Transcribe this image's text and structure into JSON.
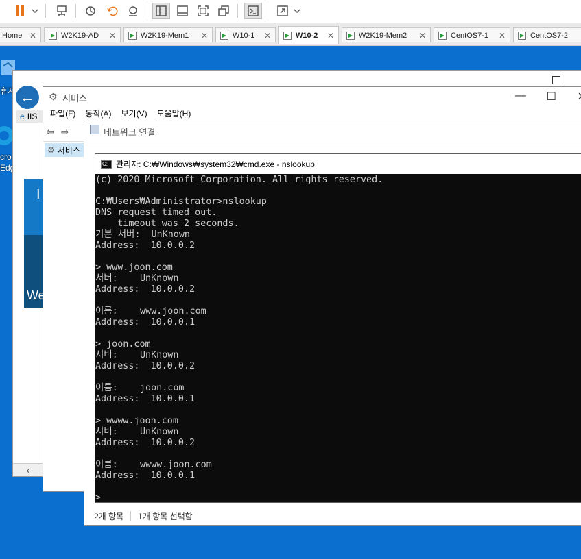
{
  "toolbar": {
    "items": [
      "pause-icon",
      "dropdown-icon",
      "network-icon",
      "snapshot-icon",
      "revert-icon",
      "manage-snapshots-icon",
      "sidebar-icon",
      "library-icon",
      "fullscreen-icon",
      "unity-icon",
      "console-icon",
      "stretch-icon",
      "dropdown-icon"
    ]
  },
  "tabs": [
    {
      "label": "Home",
      "active": false
    },
    {
      "label": "W2K19-AD",
      "active": false
    },
    {
      "label": "W2K19-Mem1",
      "active": false
    },
    {
      "label": "W10-1",
      "active": false
    },
    {
      "label": "W10-2",
      "active": true
    },
    {
      "label": "W2K19-Mem2",
      "active": false
    },
    {
      "label": "CentOS7-1",
      "active": false
    },
    {
      "label": "CentOS7-2",
      "active": false
    }
  ],
  "desktop": {
    "icon_label_1": "휴지",
    "icon_label_2": "cro",
    "icon_label_3": "Edg"
  },
  "ie_window": {
    "iis_label": "IIS",
    "panel_text": "We",
    "panel_text2": "I"
  },
  "services_window": {
    "title": "서비스",
    "menu": [
      "파일(F)",
      "동작(A)",
      "보기(V)",
      "도움말(H)"
    ],
    "tree_item": "서비스"
  },
  "network_window": {
    "title": "네트워크 연결",
    "status_left": "2개 항목",
    "status_right": "1개 항목 선택함"
  },
  "cmd_window": {
    "title": "관리자: C:₩Windows₩system32₩cmd.exe - nslookup",
    "lines": [
      "(c) 2020 Microsoft Corporation. All rights reserved.",
      "",
      "C:₩Users₩Administrator>nslookup",
      "DNS request timed out.",
      "    timeout was 2 seconds.",
      "기본 서버:  UnKnown",
      "Address:  10.0.0.2",
      "",
      "> www.joon.com",
      "서버:    UnKnown",
      "Address:  10.0.0.2",
      "",
      "이름:    www.joon.com",
      "Address:  10.0.0.1",
      "",
      "> joon.com",
      "서버:    UnKnown",
      "Address:  10.0.0.2",
      "",
      "이름:    joon.com",
      "Address:  10.0.0.1",
      "",
      "> wwww.joon.com",
      "서버:    UnKnown",
      "Address:  10.0.0.2",
      "",
      "이름:    wwww.joon.com",
      "Address:  10.0.0.1",
      "",
      ">"
    ]
  },
  "colors": {
    "desktop": "#0a6fcf",
    "console_bg": "#0c0c0c",
    "console_fg": "#cccccc",
    "pause_accent": "#e8741a"
  }
}
